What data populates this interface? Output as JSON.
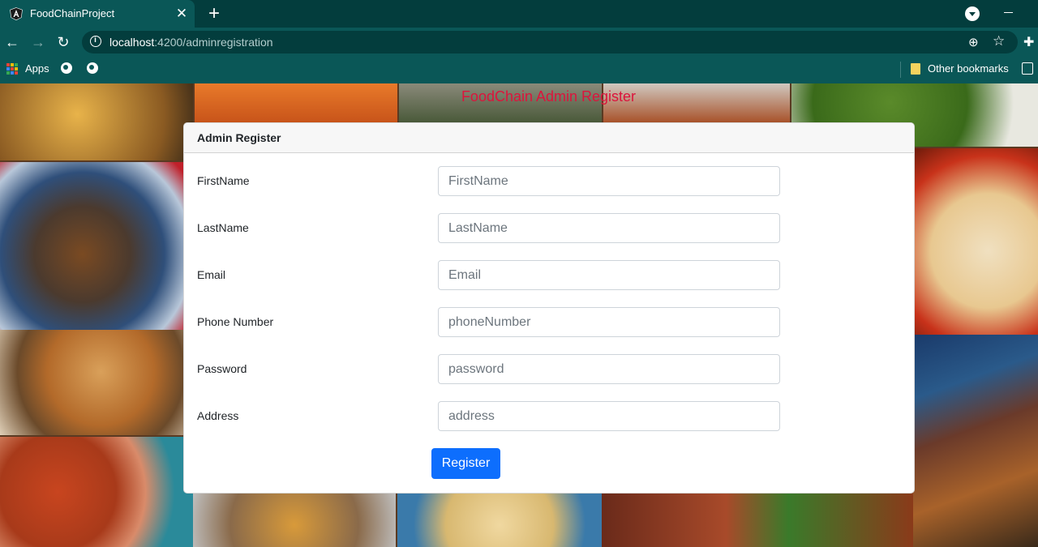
{
  "browser": {
    "tab_title": "FoodChainProject",
    "tab_favicon": "angular-logo-icon",
    "url_host": "localhost",
    "url_rest": ":4200/adminregistration",
    "bookmarks": {
      "apps_label": "Apps",
      "other_label": "Other bookmarks"
    }
  },
  "page": {
    "title": "FoodChain Admin Register",
    "title_color": "#dc143c"
  },
  "form": {
    "header": "Admin Register",
    "fields": [
      {
        "label": "FirstName",
        "placeholder": "FirstName",
        "value": ""
      },
      {
        "label": "LastName",
        "placeholder": "LastName",
        "value": ""
      },
      {
        "label": "Email",
        "placeholder": "Email",
        "value": ""
      },
      {
        "label": "Phone Number",
        "placeholder": "phoneNumber",
        "value": ""
      },
      {
        "label": "Password",
        "placeholder": "password",
        "value": ""
      },
      {
        "label": "Address",
        "placeholder": "address",
        "value": ""
      }
    ],
    "submit_label": "Register",
    "accent_color": "#0d6efd"
  }
}
